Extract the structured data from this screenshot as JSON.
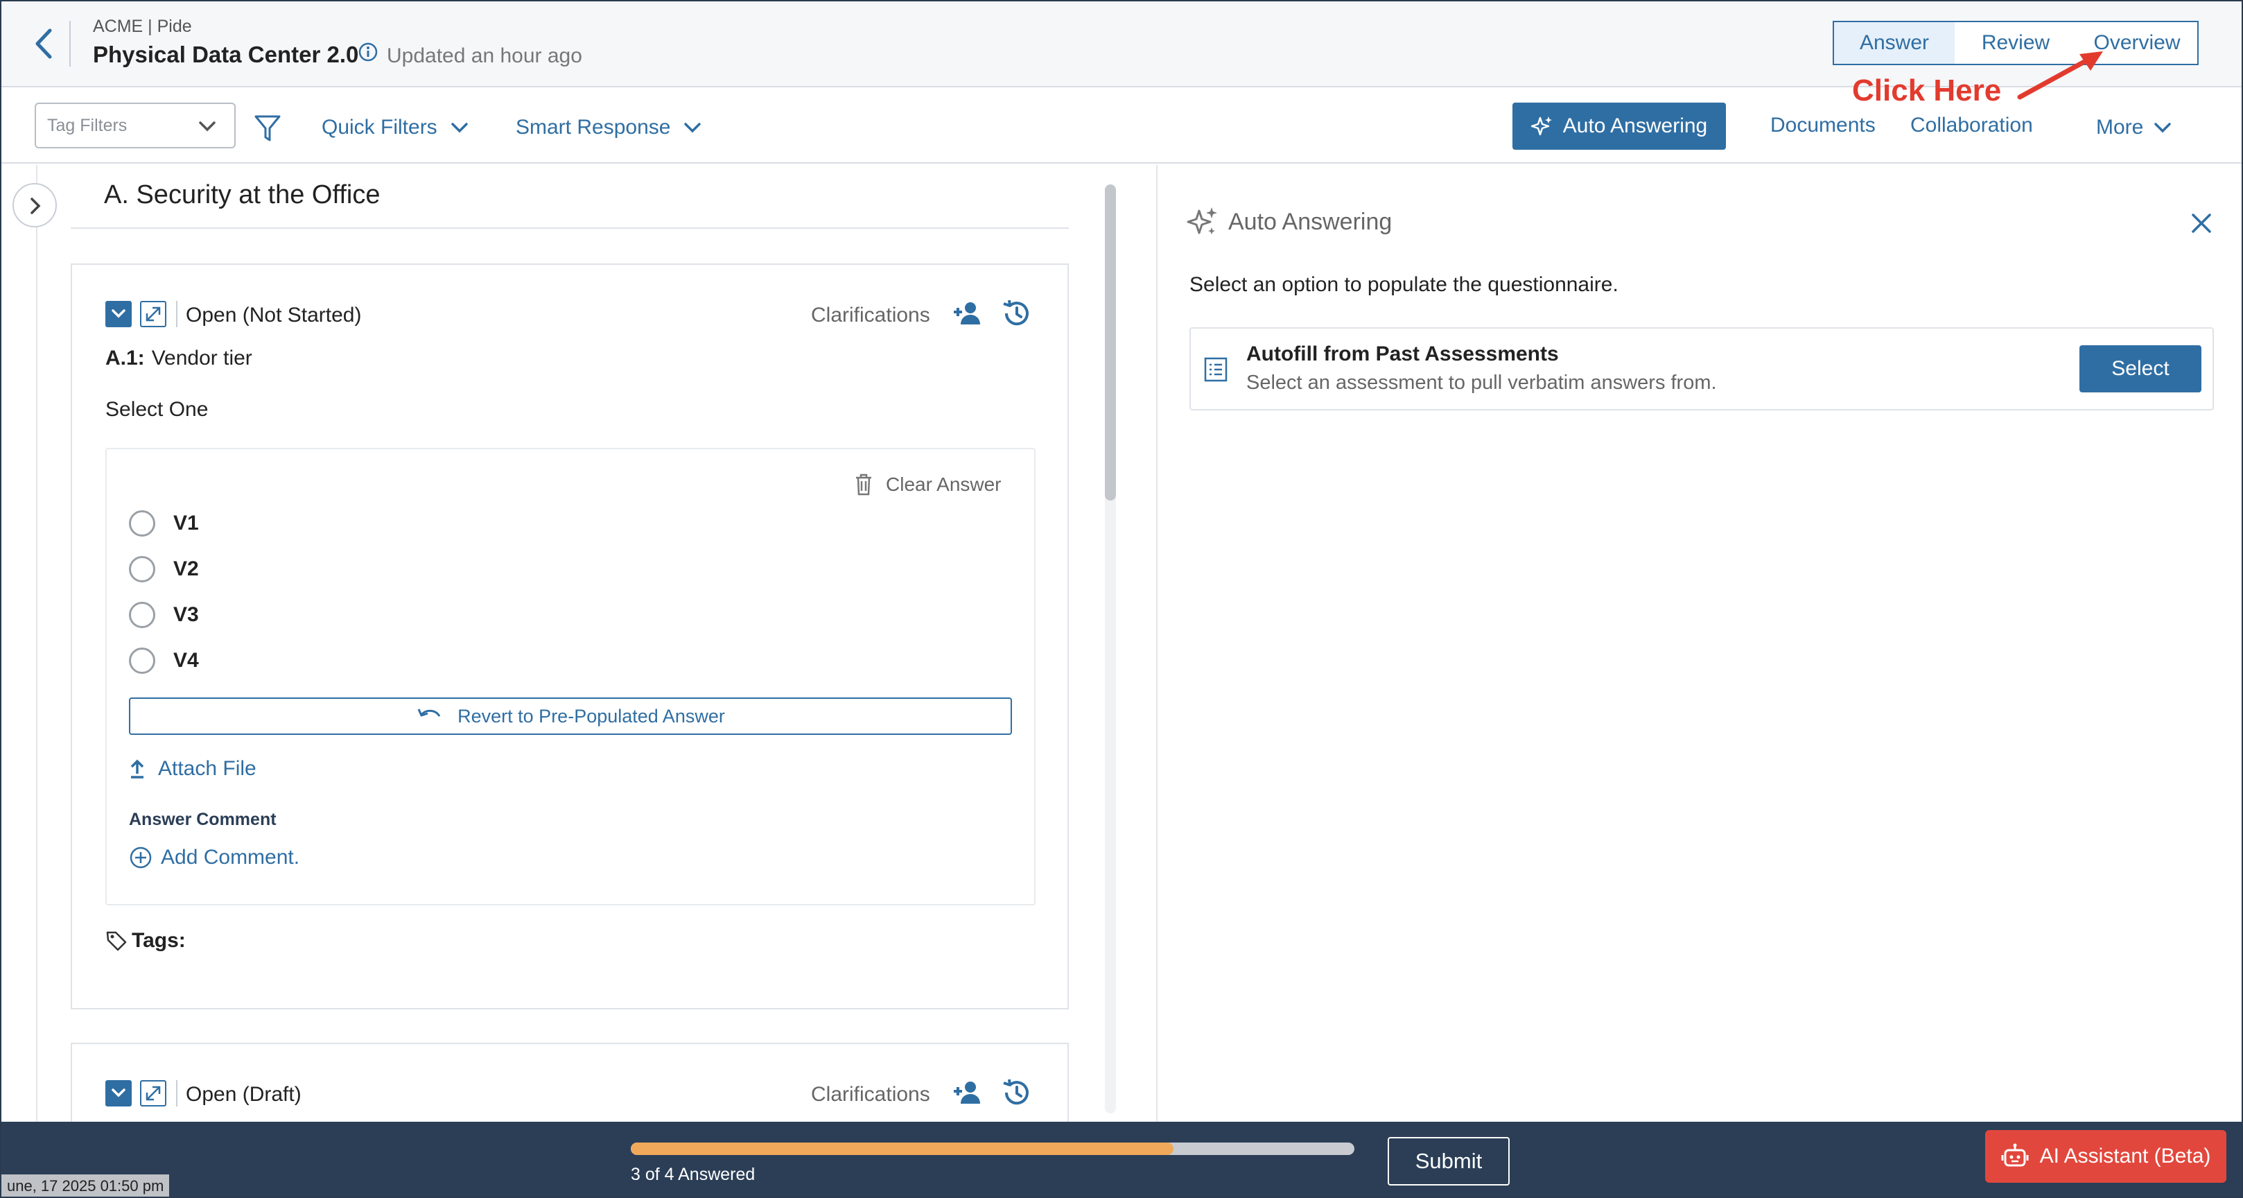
{
  "header": {
    "breadcrumb": "ACME | Pide",
    "title": "Physical Data Center 2.0",
    "updated": "Updated an hour ago",
    "tabs": [
      "Answer",
      "Review",
      "Overview"
    ]
  },
  "annotation": {
    "text": "Click Here"
  },
  "toolbar": {
    "tag_filters_placeholder": "Tag Filters",
    "quick_filters": "Quick Filters",
    "smart_response": "Smart Response",
    "auto_answering": "Auto Answering",
    "documents": "Documents",
    "collaboration": "Collaboration",
    "more": "More"
  },
  "section": {
    "title": "A. Security at the Office"
  },
  "question1": {
    "status": "Open (Not Started)",
    "clarifications": "Clarifications",
    "label_id": "A.1:",
    "label_text": "Vendor tier",
    "prompt": "Select One",
    "clear_answer": "Clear Answer",
    "options": [
      "V1",
      "V2",
      "V3",
      "V4"
    ],
    "revert": "Revert to Pre-Populated Answer",
    "attach": "Attach File",
    "comment_label": "Answer Comment",
    "add_comment": "Add Comment.",
    "tags": "Tags:"
  },
  "question2": {
    "status": "Open (Draft)",
    "clarifications": "Clarifications"
  },
  "right_panel": {
    "title": "Auto Answering",
    "instruction": "Select an option to populate the questionnaire.",
    "option_title": "Autofill from Past Assessments",
    "option_desc": "Select an assessment to pull verbatim answers from.",
    "select": "Select"
  },
  "footer": {
    "progress_text": "3 of 4 Answered",
    "progress_fraction": 0.75,
    "submit": "Submit",
    "ai_assistant": "AI Assistant (Beta)",
    "timestamp": "une, 17 2025 01:50 pm"
  },
  "colors": {
    "primary": "#2f6ea3",
    "progress": "#f0a95a",
    "footer": "#2b3e56",
    "ai_button": "#e2473d",
    "annotation": "#e23b2e"
  }
}
